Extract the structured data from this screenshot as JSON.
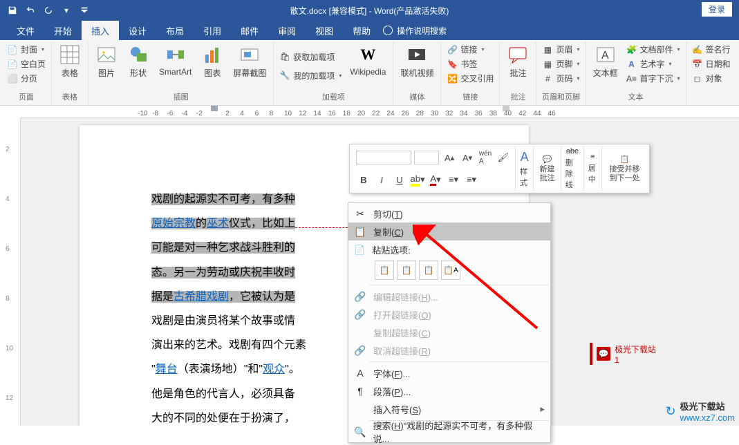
{
  "title": "散文.docx [兼容模式] - Word(产品激活失败)",
  "login": "登录",
  "tabs": [
    "文件",
    "开始",
    "插入",
    "设计",
    "布局",
    "引用",
    "邮件",
    "审阅",
    "视图",
    "帮助"
  ],
  "active_tab": 2,
  "tell_me": "操作说明搜索",
  "ribbon": {
    "pages": {
      "cover": "封面",
      "blank": "空白页",
      "break": "分页",
      "name": "页面"
    },
    "tables": {
      "table": "表格",
      "name": "表格"
    },
    "illus": {
      "pic": "图片",
      "shapes": "形状",
      "smartart": "SmartArt",
      "chart": "图表",
      "screenshot": "屏幕截图",
      "name": "插图"
    },
    "addins": {
      "get": "获取加载项",
      "my": "我的加载项",
      "wiki": "Wikipedia",
      "name": "加载项"
    },
    "media": {
      "video": "联机视频",
      "name": "媒体"
    },
    "links": {
      "link": "链接",
      "bookmark": "书签",
      "crossref": "交叉引用",
      "name": "链接"
    },
    "comments": {
      "comment": "批注",
      "name": "批注"
    },
    "headerfooter": {
      "header": "页眉",
      "footer": "页脚",
      "number": "页码",
      "name": "页眉和页脚"
    },
    "text": {
      "textbox": "文本框",
      "parts": "文档部件",
      "wordart": "艺术字",
      "dropcap": "首字下沉",
      "name": "文本"
    },
    "text2": {
      "sig": "签名行",
      "date": "日期和",
      "obj": "对象"
    }
  },
  "ruler_h": [
    "-10",
    "-8",
    "-6",
    "-4",
    "-2",
    "2",
    "4",
    "6",
    "8",
    "10",
    "12",
    "14",
    "16",
    "18",
    "20",
    "22",
    "24",
    "26",
    "28",
    "30",
    "32",
    "34",
    "36",
    "38",
    "40",
    "42",
    "44",
    "46"
  ],
  "ruler_v": [
    "2",
    "4",
    "6",
    "8",
    "10",
    "12"
  ],
  "doc": {
    "l1_a": "戏剧的起源实不可考，有多种",
    "l1_b": "",
    "l2_a": "原始宗教",
    "l2_b": "的",
    "l2_c": "巫术",
    "l2_d": "仪式，比如上",
    "l3": "可能是对一种乞求战斗胜利的",
    "l4": "态。另一为劳动或庆祝丰收时",
    "l5_a": "据是",
    "l5_b": "古希腊戏剧",
    "l5_c": "，它被认为是",
    "l6": "戏剧是由演员将某个故事或情",
    "l7": "演出来的艺术。戏剧有四个元素",
    "l8_a": "\"",
    "l8_b": "舞台",
    "l8_c": "（表演场地）\"和\"",
    "l8_d": "观众",
    "l8_e": "\"。",
    "l9": "他是角色的代言人，必须具备",
    "l10": "大的不同的处便在于扮演了，"
  },
  "mini": {
    "bold": "B",
    "italic": "I",
    "underline": "U",
    "styles": "样式",
    "newcomment": "新建批注",
    "strike": "删除线",
    "center": "居中",
    "accept": "接受并移到下一处"
  },
  "ctx": {
    "cut": "剪切",
    "cut_k": "T",
    "copy": "复制",
    "copy_k": "C",
    "paste_label": "粘贴选项:",
    "edit_link": "编辑超链接",
    "edit_link_k": "H",
    "open_link": "打开超链接",
    "open_link_k": "O",
    "copy_link": "复制超链接",
    "copy_link_k": "C",
    "cancel_sel": "取消超链接",
    "cancel_sel_k": "R",
    "font": "字体",
    "font_k": "F",
    "para": "段落",
    "para_k": "P",
    "symbol": "插入符号",
    "symbol_k": "S",
    "search": "搜索",
    "search_k": "H",
    "search_txt": "\"戏剧的起源实不可考，有多种假说..."
  },
  "comment": {
    "author": "极光下载站",
    "num": "1"
  },
  "watermark": {
    "site": "极光下载站",
    "url": "www.xz7.com"
  }
}
